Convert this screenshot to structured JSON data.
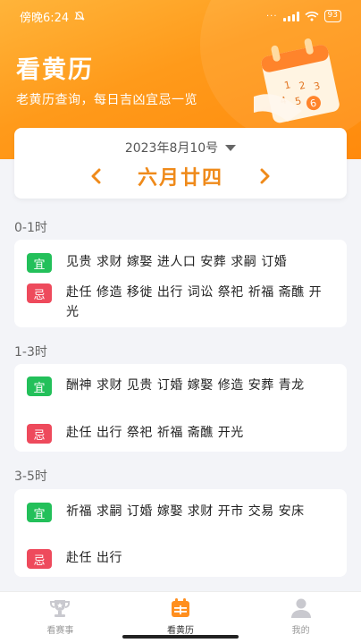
{
  "status_bar": {
    "time": "傍晚6:24",
    "battery": "93"
  },
  "header": {
    "title": "看黄历",
    "subtitle": "老黄历查询，每日吉凶宜忌一览",
    "calendar_numbers": [
      "1",
      "2",
      "3",
      "4",
      "5",
      "6"
    ]
  },
  "date_selector": {
    "solar_date": "2023年8月10号",
    "lunar_date": "六月廿四",
    "prev_icon": "chevron-left-icon",
    "next_icon": "chevron-right-icon"
  },
  "badges": {
    "yi": "宜",
    "ji": "忌"
  },
  "time_slots": [
    {
      "label": "0-1时",
      "yi": "见贵 求财 嫁娶 进人口 安葬 求嗣 订婚",
      "ji": "赴任 修造 移徙 出行 词讼 祭祀 祈福 斋醮 开光"
    },
    {
      "label": "1-3时",
      "yi": "酬神 求财 见贵 订婚 嫁娶 修造 安葬 青龙",
      "ji": "赴任 出行 祭祀 祈福 斋醮 开光"
    },
    {
      "label": "3-5时",
      "yi": "祈福 求嗣 订婚 嫁娶 求财 开市 交易 安床",
      "ji": "赴任 出行"
    }
  ],
  "tabbar": {
    "tabs": [
      {
        "label": "看赛事",
        "icon": "trophy-icon"
      },
      {
        "label": "看黄历",
        "icon": "calendar-icon"
      },
      {
        "label": "我的",
        "icon": "user-icon"
      }
    ],
    "active_index": 1
  },
  "colors": {
    "accent": "#ef8a1a",
    "yi": "#23c05a",
    "ji": "#ee4a5c"
  }
}
